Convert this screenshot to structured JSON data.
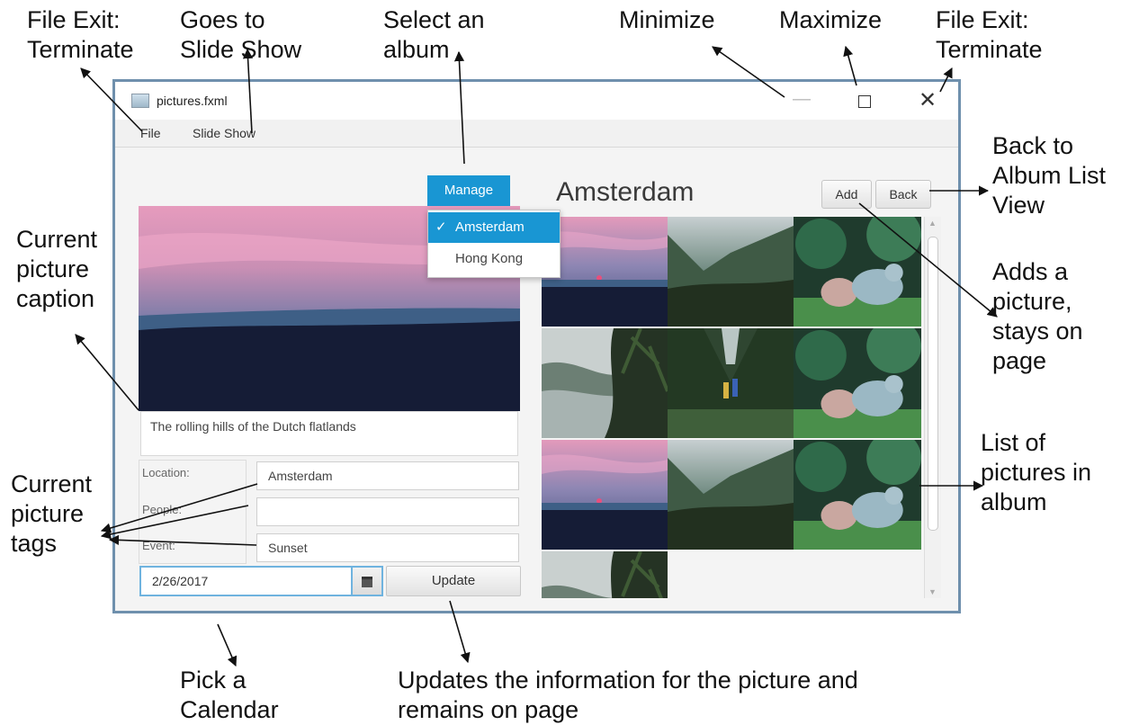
{
  "annotations": {
    "file_exit_left": [
      "File Exit:",
      "Terminate"
    ],
    "slide_show": [
      "Goes to",
      "Slide Show"
    ],
    "select_album": [
      "Select an",
      "album"
    ],
    "minimize": [
      "Minimize"
    ],
    "maximize": [
      "Maximize"
    ],
    "file_exit_right": [
      "File Exit:",
      "Terminate"
    ],
    "back_to_list": [
      "Back to",
      "Album List",
      "View"
    ],
    "current_caption": [
      "Current",
      "picture",
      "caption"
    ],
    "adds_picture": [
      "Adds a",
      "picture,",
      "stays on",
      "page"
    ],
    "list_of_pictures": [
      "List of",
      "pictures in",
      "album"
    ],
    "current_tags": [
      "Current",
      "picture",
      "tags"
    ],
    "pick_calendar": [
      "Pick a",
      "Calendar"
    ],
    "updates_info": [
      "Updates the information for the picture and",
      "remains on page"
    ]
  },
  "window": {
    "title": "pictures.fxml",
    "minimize_glyph": "—",
    "close_glyph": "✕"
  },
  "menu": {
    "file": "File",
    "slide_show": "Slide Show"
  },
  "manage": {
    "label": "Manage",
    "options": [
      {
        "label": "Amsterdam",
        "checked": true,
        "check": "✓"
      },
      {
        "label": "Hong Kong",
        "checked": false
      }
    ]
  },
  "album": {
    "title": "Amsterdam",
    "add_label": "Add",
    "back_label": "Back"
  },
  "picture": {
    "caption": "The rolling hills of the Dutch flatlands",
    "tags": {
      "location_label": "Location:",
      "location_value": "Amsterdam",
      "people_label": "People:",
      "people_value": "",
      "event_label": "Event:",
      "event_value": "Sunset"
    },
    "date": "2/26/2017",
    "update_label": "Update"
  },
  "thumbnails": [
    "sunset",
    "misty-valley",
    "otters",
    "beach-palms",
    "hikers-jungle",
    "otters",
    "sunset",
    "misty-valley",
    "otters",
    "beach-palms"
  ],
  "scroll": {
    "up_glyph": "▲",
    "down_glyph": "▼"
  },
  "colors": {
    "accent": "#1996d3",
    "window_border": "#6f90ad",
    "focus": "#6fb3df"
  }
}
